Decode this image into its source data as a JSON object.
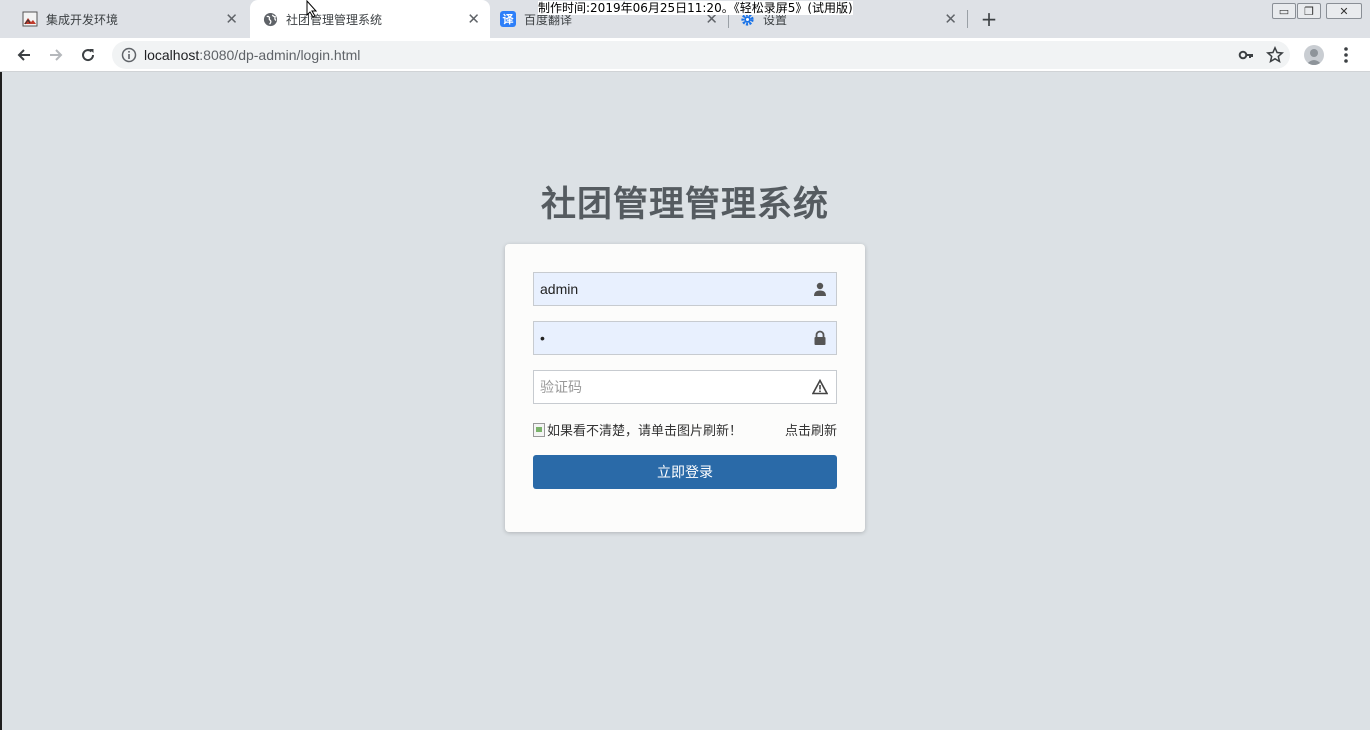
{
  "browser": {
    "tabs": [
      {
        "title": "集成开发环境",
        "icon": "image-favicon",
        "active": false
      },
      {
        "title": "社团管理管理系统",
        "icon": "globe-icon",
        "active": true
      },
      {
        "title": "百度翻译",
        "icon": "translate-icon",
        "favicon_text": "译",
        "active": false
      },
      {
        "title": "设置",
        "icon": "gear-icon",
        "active": false
      }
    ],
    "close_glyph": "✕",
    "newtab_glyph": "+",
    "url_host": "localhost",
    "url_rest": ":8080/dp-admin/login.html",
    "window_controls": [
      "▭",
      "❐",
      "✕"
    ]
  },
  "watermark": "制作时间:2019年06月25日11:20。《轻松录屏5》(试用版)",
  "page": {
    "title": "社团管理管理系统",
    "username_value": "admin",
    "password_value": "•",
    "captcha_placeholder": "验证码",
    "captcha_img_alt": "如果看不清楚，请单击图片刷新！",
    "refresh_label": "点击刷新",
    "login_label": "立即登录"
  },
  "colors": {
    "page_bg": "#dce1e5",
    "primary_button": "#2a6aa8",
    "autofill_bg": "#e8f0fe"
  }
}
